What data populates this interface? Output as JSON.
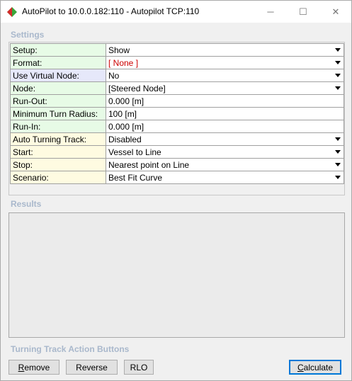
{
  "window": {
    "title": "AutoPilot to 10.0.0.182:110 - Autopilot TCP:110",
    "icon": "red-green-diamond-app-icon",
    "controls": {
      "minimize": "─",
      "maximize": "☐",
      "close": "✕"
    }
  },
  "settings": {
    "label": "Settings",
    "rows": [
      {
        "key": "Setup:",
        "value": "Show",
        "dropdown": true,
        "color": "green"
      },
      {
        "key": "Format:",
        "value": "[ None ]",
        "dropdown": true,
        "color": "green",
        "red": true
      },
      {
        "key": "Use Virtual Node:",
        "value": "No",
        "dropdown": true,
        "color": "blue"
      },
      {
        "key": "Node:",
        "value": "[Steered Node]",
        "dropdown": true,
        "color": "green"
      },
      {
        "key": "Run-Out:",
        "value": "0.000 [m]",
        "dropdown": false,
        "color": "green"
      },
      {
        "key": "Minimum Turn Radius:",
        "value": "100 [m]",
        "dropdown": false,
        "color": "green"
      },
      {
        "key": "Run-In:",
        "value": "0.000 [m]",
        "dropdown": false,
        "color": "green"
      },
      {
        "key": "Auto Turning Track:",
        "value": "Disabled",
        "dropdown": true,
        "color": "yellow"
      },
      {
        "key": "Start:",
        "value": "Vessel to Line",
        "dropdown": true,
        "color": "yellow"
      },
      {
        "key": "Stop:",
        "value": "Nearest point on Line",
        "dropdown": true,
        "color": "yellow"
      },
      {
        "key": "Scenario:",
        "value": "Best Fit Curve",
        "dropdown": true,
        "color": "yellow"
      }
    ]
  },
  "results": {
    "label": "Results"
  },
  "actions": {
    "label": "Turning Track Action Buttons",
    "remove_first": "R",
    "remove_rest": "emove",
    "reverse": "Reverse",
    "rlo": "RLO",
    "calculate_first": "C",
    "calculate_rest": "alculate"
  }
}
